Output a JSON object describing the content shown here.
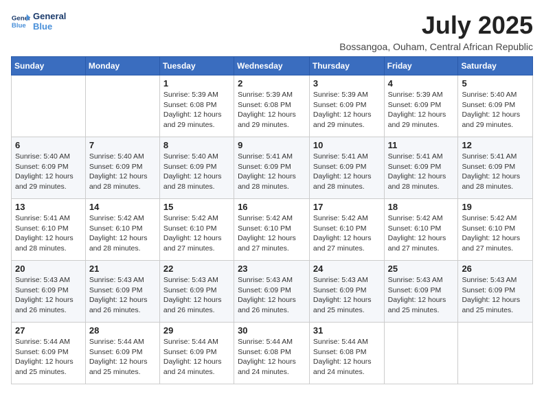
{
  "logo": {
    "line1": "General",
    "line2": "Blue"
  },
  "title": "July 2025",
  "subtitle": "Bossangoa, Ouham, Central African Republic",
  "weekdays": [
    "Sunday",
    "Monday",
    "Tuesday",
    "Wednesday",
    "Thursday",
    "Friday",
    "Saturday"
  ],
  "weeks": [
    [
      {
        "day": "",
        "info": ""
      },
      {
        "day": "",
        "info": ""
      },
      {
        "day": "1",
        "info": "Sunrise: 5:39 AM\nSunset: 6:08 PM\nDaylight: 12 hours and 29 minutes."
      },
      {
        "day": "2",
        "info": "Sunrise: 5:39 AM\nSunset: 6:08 PM\nDaylight: 12 hours and 29 minutes."
      },
      {
        "day": "3",
        "info": "Sunrise: 5:39 AM\nSunset: 6:09 PM\nDaylight: 12 hours and 29 minutes."
      },
      {
        "day": "4",
        "info": "Sunrise: 5:39 AM\nSunset: 6:09 PM\nDaylight: 12 hours and 29 minutes."
      },
      {
        "day": "5",
        "info": "Sunrise: 5:40 AM\nSunset: 6:09 PM\nDaylight: 12 hours and 29 minutes."
      }
    ],
    [
      {
        "day": "6",
        "info": "Sunrise: 5:40 AM\nSunset: 6:09 PM\nDaylight: 12 hours and 29 minutes."
      },
      {
        "day": "7",
        "info": "Sunrise: 5:40 AM\nSunset: 6:09 PM\nDaylight: 12 hours and 28 minutes."
      },
      {
        "day": "8",
        "info": "Sunrise: 5:40 AM\nSunset: 6:09 PM\nDaylight: 12 hours and 28 minutes."
      },
      {
        "day": "9",
        "info": "Sunrise: 5:41 AM\nSunset: 6:09 PM\nDaylight: 12 hours and 28 minutes."
      },
      {
        "day": "10",
        "info": "Sunrise: 5:41 AM\nSunset: 6:09 PM\nDaylight: 12 hours and 28 minutes."
      },
      {
        "day": "11",
        "info": "Sunrise: 5:41 AM\nSunset: 6:09 PM\nDaylight: 12 hours and 28 minutes."
      },
      {
        "day": "12",
        "info": "Sunrise: 5:41 AM\nSunset: 6:09 PM\nDaylight: 12 hours and 28 minutes."
      }
    ],
    [
      {
        "day": "13",
        "info": "Sunrise: 5:41 AM\nSunset: 6:10 PM\nDaylight: 12 hours and 28 minutes."
      },
      {
        "day": "14",
        "info": "Sunrise: 5:42 AM\nSunset: 6:10 PM\nDaylight: 12 hours and 28 minutes."
      },
      {
        "day": "15",
        "info": "Sunrise: 5:42 AM\nSunset: 6:10 PM\nDaylight: 12 hours and 27 minutes."
      },
      {
        "day": "16",
        "info": "Sunrise: 5:42 AM\nSunset: 6:10 PM\nDaylight: 12 hours and 27 minutes."
      },
      {
        "day": "17",
        "info": "Sunrise: 5:42 AM\nSunset: 6:10 PM\nDaylight: 12 hours and 27 minutes."
      },
      {
        "day": "18",
        "info": "Sunrise: 5:42 AM\nSunset: 6:10 PM\nDaylight: 12 hours and 27 minutes."
      },
      {
        "day": "19",
        "info": "Sunrise: 5:42 AM\nSunset: 6:10 PM\nDaylight: 12 hours and 27 minutes."
      }
    ],
    [
      {
        "day": "20",
        "info": "Sunrise: 5:43 AM\nSunset: 6:09 PM\nDaylight: 12 hours and 26 minutes."
      },
      {
        "day": "21",
        "info": "Sunrise: 5:43 AM\nSunset: 6:09 PM\nDaylight: 12 hours and 26 minutes."
      },
      {
        "day": "22",
        "info": "Sunrise: 5:43 AM\nSunset: 6:09 PM\nDaylight: 12 hours and 26 minutes."
      },
      {
        "day": "23",
        "info": "Sunrise: 5:43 AM\nSunset: 6:09 PM\nDaylight: 12 hours and 26 minutes."
      },
      {
        "day": "24",
        "info": "Sunrise: 5:43 AM\nSunset: 6:09 PM\nDaylight: 12 hours and 25 minutes."
      },
      {
        "day": "25",
        "info": "Sunrise: 5:43 AM\nSunset: 6:09 PM\nDaylight: 12 hours and 25 minutes."
      },
      {
        "day": "26",
        "info": "Sunrise: 5:43 AM\nSunset: 6:09 PM\nDaylight: 12 hours and 25 minutes."
      }
    ],
    [
      {
        "day": "27",
        "info": "Sunrise: 5:44 AM\nSunset: 6:09 PM\nDaylight: 12 hours and 25 minutes."
      },
      {
        "day": "28",
        "info": "Sunrise: 5:44 AM\nSunset: 6:09 PM\nDaylight: 12 hours and 25 minutes."
      },
      {
        "day": "29",
        "info": "Sunrise: 5:44 AM\nSunset: 6:09 PM\nDaylight: 12 hours and 24 minutes."
      },
      {
        "day": "30",
        "info": "Sunrise: 5:44 AM\nSunset: 6:08 PM\nDaylight: 12 hours and 24 minutes."
      },
      {
        "day": "31",
        "info": "Sunrise: 5:44 AM\nSunset: 6:08 PM\nDaylight: 12 hours and 24 minutes."
      },
      {
        "day": "",
        "info": ""
      },
      {
        "day": "",
        "info": ""
      }
    ]
  ]
}
